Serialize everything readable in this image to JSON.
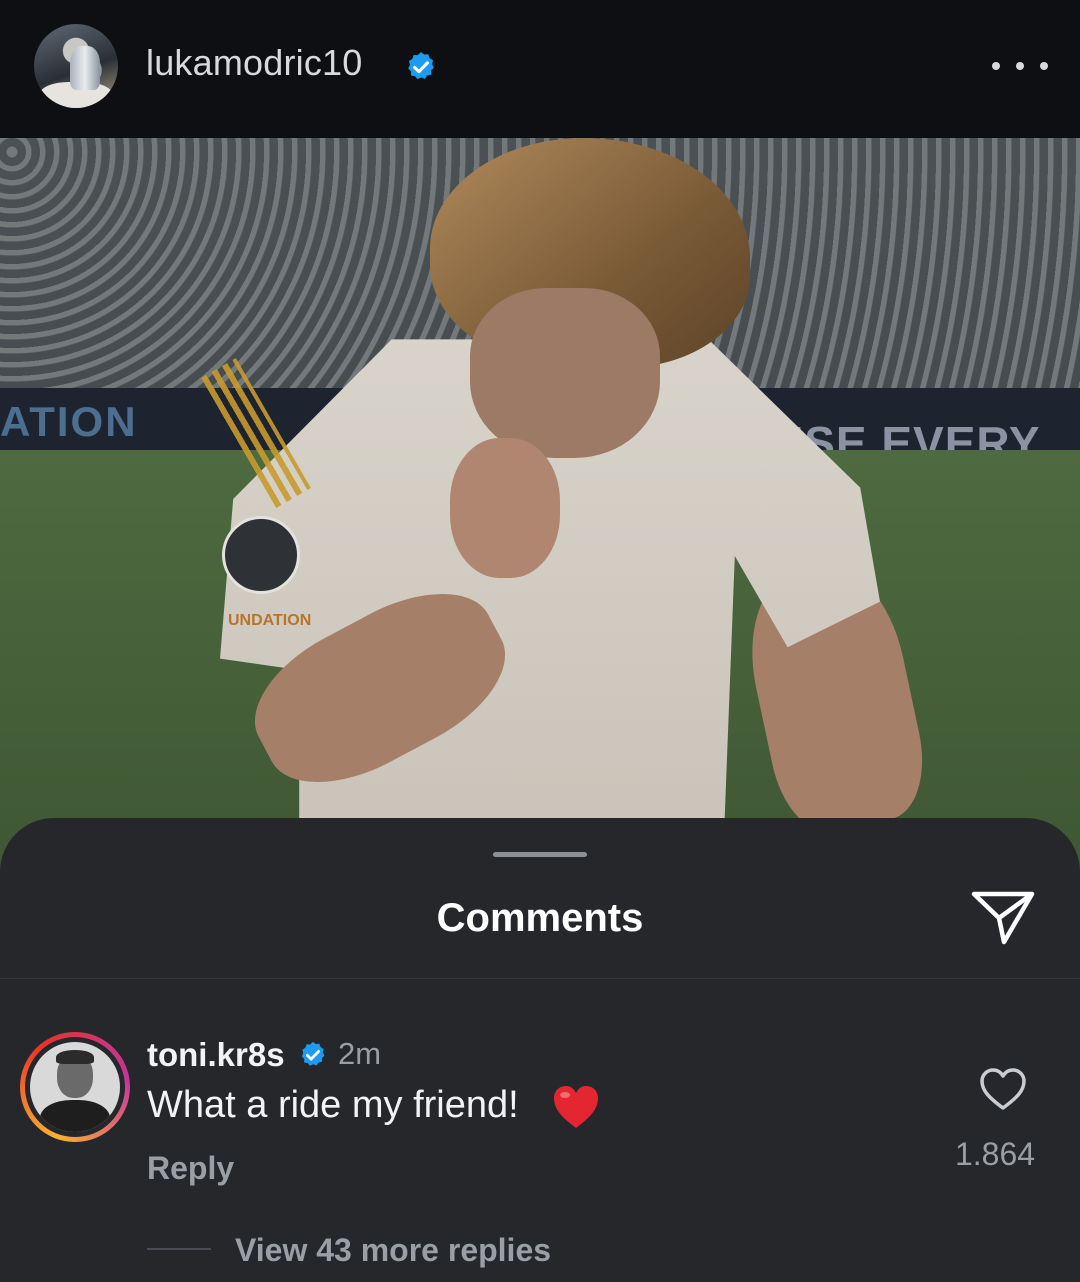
{
  "header": {
    "username": "lukamodric10",
    "verified_icon": "verified-badge-icon",
    "more_icon": "more-options-icon"
  },
  "post": {
    "image_alt_icon": "post-photo",
    "hoarding_left": "ATION",
    "hoarding_right": "USE EVERY CH",
    "sleeve_text": "UNDATION"
  },
  "comments_sheet": {
    "title": "Comments",
    "share_icon": "send-icon",
    "comments": [
      {
        "username": "toni.kr8s",
        "verified": true,
        "time": "2m",
        "text": "What a ride my friend!",
        "emoji": "heart-emoji",
        "reply_label": "Reply",
        "likes": "1.864",
        "view_replies": "View 43 more replies"
      }
    ]
  },
  "colors": {
    "background": "#0f1114",
    "sheet": "#25272b",
    "verified_blue": "#1d9bf0",
    "secondary_text": "#9a9ea5"
  }
}
